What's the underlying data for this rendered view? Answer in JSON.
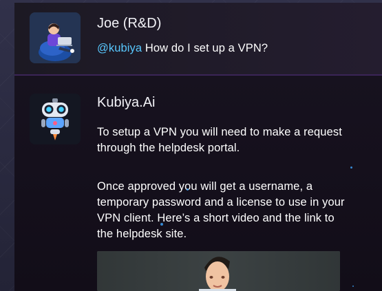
{
  "messages": [
    {
      "author": "Joe (R&D)",
      "mention": "@kubiya",
      "text": " How do I set up a VPN?",
      "avatar_icon": "user-on-beanbag-avatar-icon"
    },
    {
      "author": "Kubiya.Ai",
      "paragraphs": [
        "To setup a VPN you will need to make a request through the helpdesk portal.",
        "Once approved you will get a username, a temporary password and a license to use in your VPN client. Here’s a short video and the link to the helpdesk site."
      ],
      "avatar_icon": "robot-avatar-icon",
      "attachment_icon": "video-presenter-icon"
    }
  ],
  "colors": {
    "mention": "#58c8ff",
    "divider": "#3b2557",
    "background": "#120d19"
  }
}
